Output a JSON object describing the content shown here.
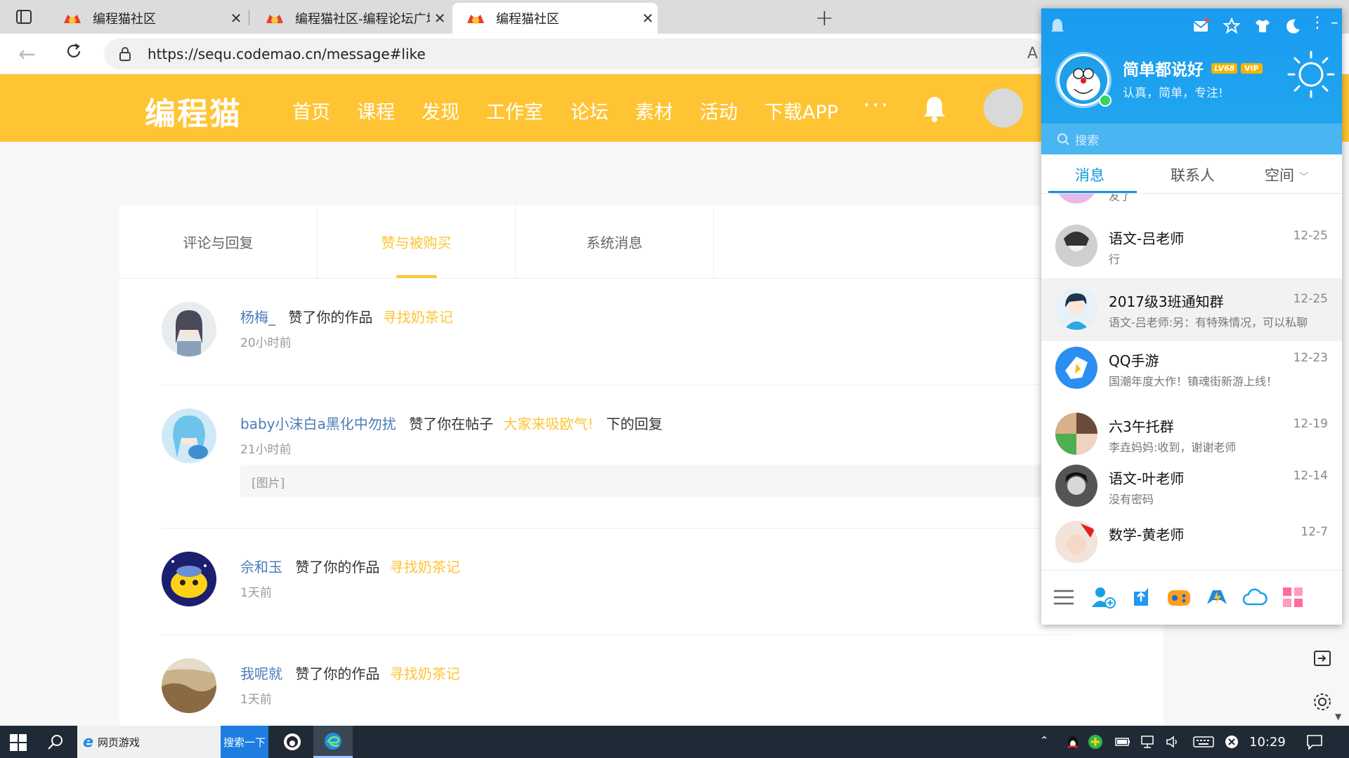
{
  "browser": {
    "tabs": [
      {
        "title": "编程猫社区",
        "active": false
      },
      {
        "title": "编程猫社区-编程论坛广场-编程学习",
        "active": false
      },
      {
        "title": "编程猫社区",
        "active": true
      }
    ],
    "url": "https://sequ.codemao.cn/message#like",
    "reader_glyph": "A"
  },
  "site": {
    "logo": "编程猫",
    "nav": [
      "首页",
      "课程",
      "发现",
      "工作室",
      "论坛",
      "素材",
      "活动",
      "下载APP"
    ],
    "more": "···",
    "brand_color": "#fec433"
  },
  "content": {
    "tabs": [
      "评论与回复",
      "赞与被购买",
      "系统消息"
    ],
    "active_tab": 1,
    "messages": [
      {
        "user": "杨梅_",
        "action": "赞了你的作品",
        "target": "寻找奶茶记",
        "tail": "",
        "time": "20小时前",
        "quote": ""
      },
      {
        "user": "baby小沫白a黑化中勿扰",
        "action": "赞了你在帖子",
        "target": "大家来吸欧气!",
        "tail": "下的回复",
        "time": "21小时前",
        "quote": "[图片]"
      },
      {
        "user": "佘和玉",
        "action": "赞了你的作品",
        "target": "寻找奶茶记",
        "tail": "",
        "time": "1天前",
        "quote": ""
      },
      {
        "user": "我呢就",
        "action": "赞了你的作品",
        "target": "寻找奶茶记",
        "tail": "",
        "time": "1天前",
        "quote": ""
      }
    ]
  },
  "qq": {
    "nickname": "简单都说好",
    "level_badge": "LV68",
    "vip_badge": "VIP",
    "signature": "认真，简单，专注!",
    "search_placeholder": "搜索",
    "tabs": [
      "消息",
      "联系人",
      "空间"
    ],
    "active_tab": 0,
    "partial_top_preview": "友了",
    "conversations": [
      {
        "name": "语文-吕老师",
        "time": "12-25",
        "preview": "行"
      },
      {
        "name": "2017级3班通知群",
        "time": "12-25",
        "preview": "语文-吕老师:另：有特殊情况，可以私聊"
      },
      {
        "name": "QQ手游",
        "time": "12-23",
        "preview": "国潮年度大作！镇魂街新游上线！"
      },
      {
        "name": "六3午托群",
        "time": "12-19",
        "preview": "李垚妈妈:收到，谢谢老师"
      },
      {
        "name": "语文-叶老师",
        "time": "12-14",
        "preview": "没有密码"
      },
      {
        "name": "数学-黄老师",
        "time": "12-7",
        "preview": ""
      }
    ],
    "accent": "#1296db"
  },
  "taskbar": {
    "webgame_label": "网页游戏",
    "search_button": "搜索一下",
    "clock": "10:29"
  }
}
